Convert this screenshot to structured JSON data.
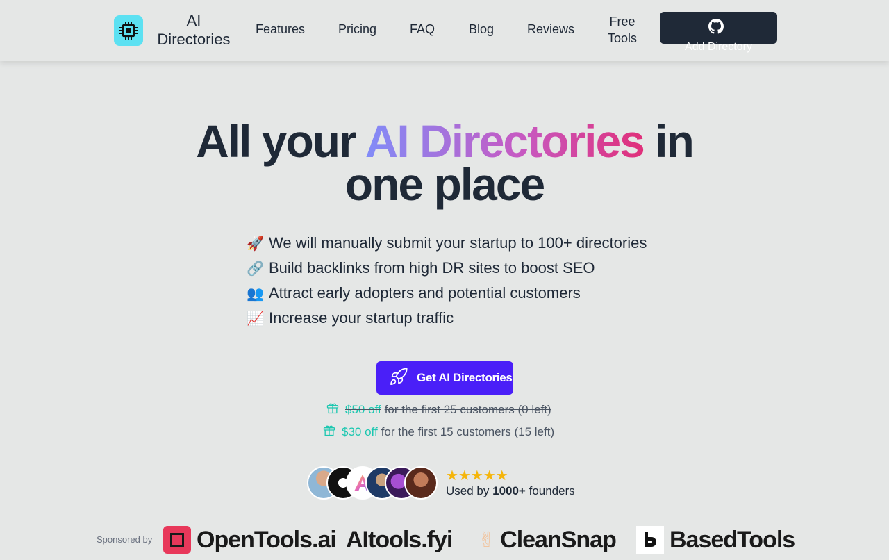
{
  "nav": {
    "brand": "AI Directories",
    "links": [
      "Features",
      "Pricing",
      "FAQ",
      "Blog",
      "Reviews"
    ],
    "free_tools": "Free Tools",
    "add_directory": "Add Directory"
  },
  "hero": {
    "before": "All your",
    "highlight": "AI Directories",
    "after": "in",
    "line2": "one place"
  },
  "features": [
    {
      "emoji": "🚀",
      "text": "We will manually submit your startup to 100+ directories"
    },
    {
      "emoji": "🔗",
      "text": "Build backlinks from high DR sites to boost SEO"
    },
    {
      "emoji": "👥",
      "text": "Attract early adopters and potential customers"
    },
    {
      "emoji": "📈",
      "text": "Increase your startup traffic"
    }
  ],
  "cta": {
    "label": "Get AI Directories"
  },
  "offers": [
    {
      "amount": "$50 off",
      "text": "for the first 25 customers (0 left)"
    },
    {
      "amount": "$30 off",
      "text": "for the first 15 customers (15 left)"
    }
  ],
  "social_proof": {
    "stars": "★★★★★",
    "used_prefix": "Used by",
    "count": "1000+",
    "suffix": "founders",
    "rating": 5
  },
  "sponsors": {
    "label": "Sponsored by",
    "items": [
      "OpenTools.ai",
      "AItools.fyi",
      "CleanSnap",
      "BasedTools"
    ]
  },
  "colors": {
    "background": "#e5e7e6",
    "cta": "#4a1ff8",
    "accent_teal": "#1cc7b0",
    "dark": "#1f2937",
    "logo": "#5ce1f2"
  }
}
